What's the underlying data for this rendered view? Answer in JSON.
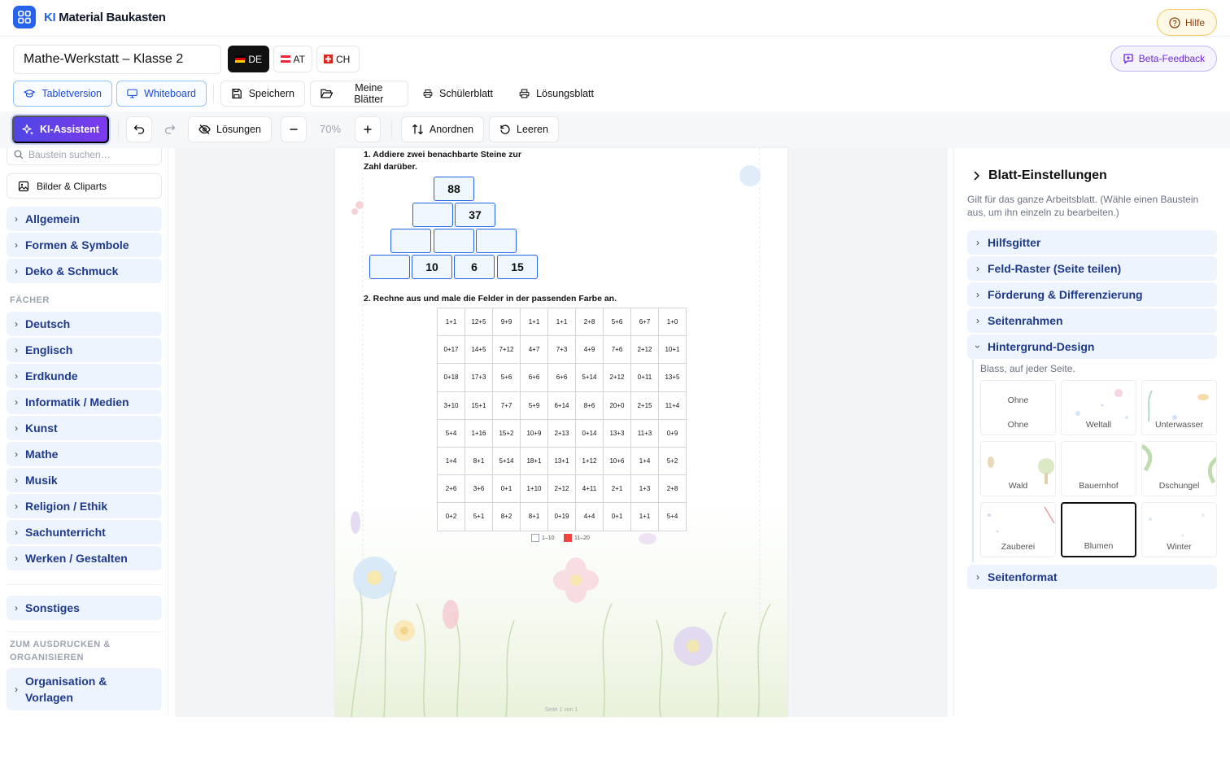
{
  "app": {
    "brand_prefix": "KI",
    "brand_name": "Material Baukasten",
    "help": "Hilfe",
    "beta_feedback": "Beta-Feedback"
  },
  "document": {
    "title": "Mathe-Werkstatt – Klasse 2"
  },
  "countries": [
    {
      "label": "DE",
      "active": true
    },
    {
      "label": "AT",
      "active": false
    },
    {
      "label": "CH",
      "active": false
    }
  ],
  "view_modes": {
    "tablet": "Tabletversion",
    "whiteboard": "Whiteboard"
  },
  "file_actions": {
    "save": "Speichern",
    "my_sheets": "Meine Blätter",
    "student_sheet": "Schülerblatt",
    "solution_sheet": "Lösungsblatt"
  },
  "toolbar": {
    "ai_assistant": "KI-Assistent",
    "solutions": "Lösungen",
    "zoom": "70%",
    "arrange": "Anordnen",
    "clear": "Leeren"
  },
  "sidebar": {
    "search_placeholder": "Baustein suchen…",
    "images": "Bilder & Cliparts",
    "general_items": [
      "Allgemein",
      "Formen & Symbole",
      "Deko & Schmuck"
    ],
    "subjects_heading": "FÄCHER",
    "subjects": [
      "Deutsch",
      "Englisch",
      "Erdkunde",
      "Informatik / Medien",
      "Kunst",
      "Mathe",
      "Musik",
      "Religion / Ethik",
      "Sachunterricht",
      "Werken / Gestalten"
    ],
    "other": "Sonstiges",
    "print_heading_line1": "ZUM AUSDRUCKEN &",
    "print_heading_line2": "ORGANISIEREN",
    "print_item_line1": "Organisation &",
    "print_item_line2": "Vorlagen"
  },
  "worksheet": {
    "task1_line1": "1. Addiere zwei benachbarte Steine zur",
    "task1_line2": "Zahl darüber.",
    "pyramid": {
      "row1": [
        "88"
      ],
      "row2": [
        "",
        "37"
      ],
      "row3": [
        "",
        "",
        ""
      ],
      "row4": [
        "",
        "10",
        "6",
        "15"
      ]
    },
    "task2": "2. Rechne aus und male die Felder in der passenden Farbe an.",
    "grid": [
      [
        "1+1",
        "12+5",
        "9+9",
        "1+1",
        "1+1",
        "2+8",
        "5+6",
        "6+7",
        "1+0"
      ],
      [
        "0+17",
        "14+5",
        "7+12",
        "4+7",
        "7+3",
        "4+9",
        "7+6",
        "2+12",
        "10+1"
      ],
      [
        "0+18",
        "17+3",
        "5+6",
        "6+6",
        "6+6",
        "5+14",
        "2+12",
        "0+11",
        "13+5"
      ],
      [
        "3+10",
        "15+1",
        "7+7",
        "5+9",
        "6+14",
        "8+6",
        "20+0",
        "2+15",
        "11+4"
      ],
      [
        "5+4",
        "1+16",
        "15+2",
        "10+9",
        "2+13",
        "0+14",
        "13+3",
        "11+3",
        "0+9"
      ],
      [
        "1+4",
        "8+1",
        "5+14",
        "18+1",
        "13+1",
        "1+12",
        "10+6",
        "1+4",
        "5+2"
      ],
      [
        "2+6",
        "3+6",
        "0+1",
        "1+10",
        "2+12",
        "4+11",
        "2+1",
        "1+3",
        "2+8"
      ],
      [
        "0+2",
        "5+1",
        "8+2",
        "8+1",
        "0+19",
        "4+4",
        "0+1",
        "1+1",
        "5+4"
      ]
    ],
    "legend": [
      {
        "label": "1–10",
        "color": "#ffffff"
      },
      {
        "label": "11–20",
        "color": "#ef4444"
      }
    ],
    "footer": "Seite 1 von 1"
  },
  "settings": {
    "title": "Blatt-Einstellungen",
    "description": "Gilt für das ganze Arbeitsblatt. (Wähle einen Baustein aus, um ihn einzeln zu bearbeiten.)",
    "sections": [
      "Hilfsgitter",
      "Feld-Raster (Seite teilen)",
      "Förderung & Differenzierung",
      "Seitenrahmen",
      "Hintergrund-Design",
      "Seitenformat"
    ],
    "background_hint": "Blass, auf jeder Seite.",
    "none_preview": "Ohne",
    "backgrounds": [
      "Ohne",
      "Weltall",
      "Unterwasser",
      "Wald",
      "Bauernhof",
      "Dschungel",
      "Zauberei",
      "Blumen",
      "Winter"
    ],
    "selected_background": "Blumen"
  },
  "colors": {
    "accent": "#2563eb",
    "ai_gradient_start": "#4f46e5",
    "ai_gradient_end": "#7c3aed",
    "nav_bg": "#eef4fd",
    "nav_text": "#1e3a8a"
  }
}
